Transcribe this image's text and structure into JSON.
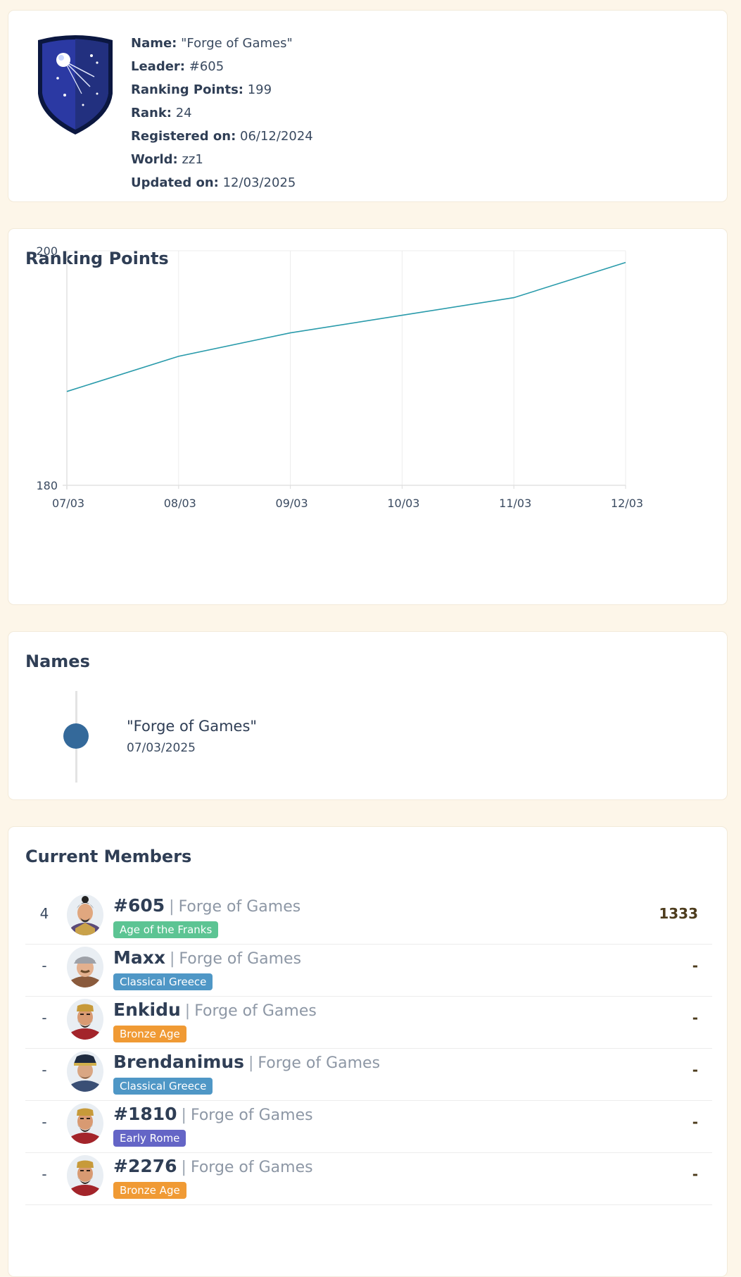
{
  "info": {
    "rows": [
      {
        "label": "Name:",
        "value": "\"Forge of Games\""
      },
      {
        "label": "Leader:",
        "value": "#605"
      },
      {
        "label": "Ranking Points:",
        "value": "199"
      },
      {
        "label": "Rank:",
        "value": "24"
      },
      {
        "label": "Registered on:",
        "value": "06/12/2024"
      },
      {
        "label": "World:",
        "value": "zz1"
      },
      {
        "label": "Updated on:",
        "value": "12/03/2025"
      }
    ],
    "emblem_icon": "satellite-shield-emblem-icon"
  },
  "ranking": {
    "title": "Ranking Points"
  },
  "chart_data": {
    "type": "line",
    "title": "Ranking Points",
    "x": [
      "07/03",
      "08/03",
      "09/03",
      "10/03",
      "11/03",
      "12/03"
    ],
    "series": [
      {
        "values": [
          188,
          191,
          193,
          194.5,
          196,
          199
        ]
      }
    ],
    "ylim": [
      180,
      200
    ],
    "yticks": [
      "200",
      "180"
    ],
    "grid": true,
    "color": "#2a9bab"
  },
  "names": {
    "title": "Names",
    "entries": [
      {
        "name": "\"Forge of Games\"",
        "date": "07/03/2025"
      }
    ]
  },
  "members": {
    "title": "Current Members",
    "rows": [
      {
        "rank": "4",
        "name": "#605",
        "guild": "Forge of Games",
        "age": "Age of the Franks",
        "age_color": "#5cc493",
        "points": "1333",
        "avatar": "samurai-avatar-icon"
      },
      {
        "rank": "-",
        "name": "Maxx",
        "guild": "Forge of Games",
        "age": "Classical Greece",
        "age_color": "#4f97c6",
        "points": "-",
        "avatar": "helmeted-soldier-avatar-icon"
      },
      {
        "rank": "-",
        "name": "Enkidu",
        "guild": "Forge of Games",
        "age": "Bronze Age",
        "age_color": "#f09a34",
        "points": "-",
        "avatar": "bearded-king-avatar-icon"
      },
      {
        "rank": "-",
        "name": "Brendanimus",
        "guild": "Forge of Games",
        "age": "Classical Greece",
        "age_color": "#4f97c6",
        "points": "-",
        "avatar": "general-avatar-icon"
      },
      {
        "rank": "-",
        "name": "#1810",
        "guild": "Forge of Games",
        "age": "Early Rome",
        "age_color": "#6465c6",
        "points": "-",
        "avatar": "bearded-king-avatar-icon"
      },
      {
        "rank": "-",
        "name": "#2276",
        "guild": "Forge of Games",
        "age": "Bronze Age",
        "age_color": "#f09a34",
        "points": "-",
        "avatar": "bearded-king-avatar-icon"
      }
    ]
  }
}
